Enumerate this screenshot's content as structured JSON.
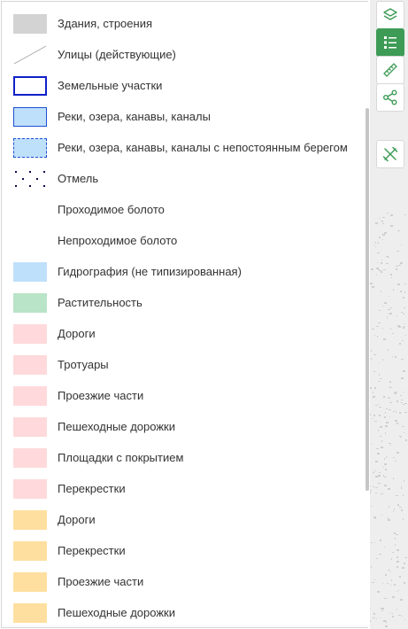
{
  "legend": {
    "items": [
      {
        "label": "Здания, строения",
        "swatch": "building"
      },
      {
        "label": "Улицы (действующие)",
        "swatch": "street-line"
      },
      {
        "label": "Земельные участки",
        "swatch": "land-plot"
      },
      {
        "label": "Реки, озера, канавы, каналы",
        "swatch": "water"
      },
      {
        "label": "Реки, озера, канавы, каналы с непостоянным берегом",
        "swatch": "water-dashed"
      },
      {
        "label": "Отмель",
        "swatch": "shoal-dots"
      },
      {
        "label": "Проходимое болото",
        "swatch": "none"
      },
      {
        "label": "Непроходимое болото",
        "swatch": "none"
      },
      {
        "label": "Гидрография (не типизированная)",
        "swatch": "hydro"
      },
      {
        "label": "Растительность",
        "swatch": "vegetation"
      },
      {
        "label": "Дороги",
        "swatch": "pink"
      },
      {
        "label": "Тротуары",
        "swatch": "pink"
      },
      {
        "label": "Проезжие части",
        "swatch": "pink"
      },
      {
        "label": "Пешеходные дорожки",
        "swatch": "pink"
      },
      {
        "label": "Площадки с покрытием",
        "swatch": "pink"
      },
      {
        "label": "Перекрестки",
        "swatch": "pink"
      },
      {
        "label": "Дороги",
        "swatch": "orange"
      },
      {
        "label": "Перекрестки",
        "swatch": "orange"
      },
      {
        "label": "Проезжие части",
        "swatch": "orange"
      },
      {
        "label": "Пешеходные дорожки",
        "swatch": "orange"
      }
    ]
  },
  "toolbar": {
    "buttons": [
      {
        "icon": "layers-icon",
        "active": false
      },
      {
        "icon": "legend-list-icon",
        "active": true
      },
      {
        "icon": "ruler-icon",
        "active": false
      },
      {
        "icon": "share-icon",
        "active": false
      },
      {
        "icon": "tools-icon",
        "active": false
      }
    ]
  },
  "colors": {
    "accent": "#3d9b55",
    "building": "#d3d3d3",
    "water_fill": "#bfe0fb",
    "water_border": "#1f4fd0",
    "land_plot_border": "#1020c8",
    "vegetation": "#b9e4c7",
    "pink": "#ffd9db",
    "orange": "#ffdf9f"
  }
}
